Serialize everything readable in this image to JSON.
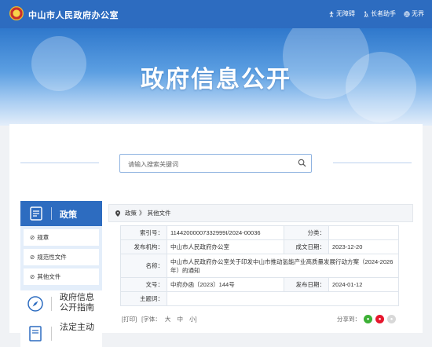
{
  "header": {
    "site_title": "中山市人民政府办公室",
    "links": [
      {
        "label": "无障碍",
        "icon": "accessibility-icon"
      },
      {
        "label": "长者助手",
        "icon": "elder-assist-icon"
      },
      {
        "label": "无界",
        "icon": "globe-icon"
      }
    ]
  },
  "banner": {
    "title": "政府信息公开"
  },
  "search": {
    "placeholder": "请输入搜索关键词"
  },
  "sidebar": {
    "section_title": "政策",
    "items": [
      {
        "label": "规章"
      },
      {
        "label": "规范性文件"
      },
      {
        "label": "其他文件"
      }
    ],
    "blocks": [
      {
        "label_line1": "政府信息",
        "label_line2": "公开指南",
        "icon": "compass-icon"
      },
      {
        "label_line1": "法定主动",
        "label_line2": "",
        "icon": "document-icon"
      }
    ]
  },
  "breadcrumb": {
    "home": "政策",
    "sep": "》",
    "current": "其他文件"
  },
  "meta": {
    "index_label": "索引号：",
    "index_value": "11442000007332999I/2024-00036",
    "category_label": "分类：",
    "category_value": "",
    "issuer_label": "发布机构：",
    "issuer_value": "中山市人民政府办公室",
    "created_label": "成文日期：",
    "created_value": "2023-12-20",
    "name_label": "名称：",
    "name_value": "中山市人民政府办公室关于印发中山市推动氢能产业高质量发展行动方案（2024-2026年）的通知",
    "docno_label": "文号：",
    "docno_value": "中府办函〔2023〕144号",
    "published_label": "发布日期：",
    "published_value": "2024-01-12",
    "subject_label": "主题词：",
    "subject_value": ""
  },
  "toolbar": {
    "print": "[打印]",
    "font_label": "[字体：",
    "font_large": "大",
    "font_medium": "中",
    "font_small": "小]"
  },
  "share": {
    "label": "分享到："
  },
  "colors": {
    "brand": "#2d6cc0",
    "banner_light": "#a9cdf2",
    "wechat": "#3cb035",
    "weibo": "#e6162d",
    "other": "#d8d8d8"
  }
}
